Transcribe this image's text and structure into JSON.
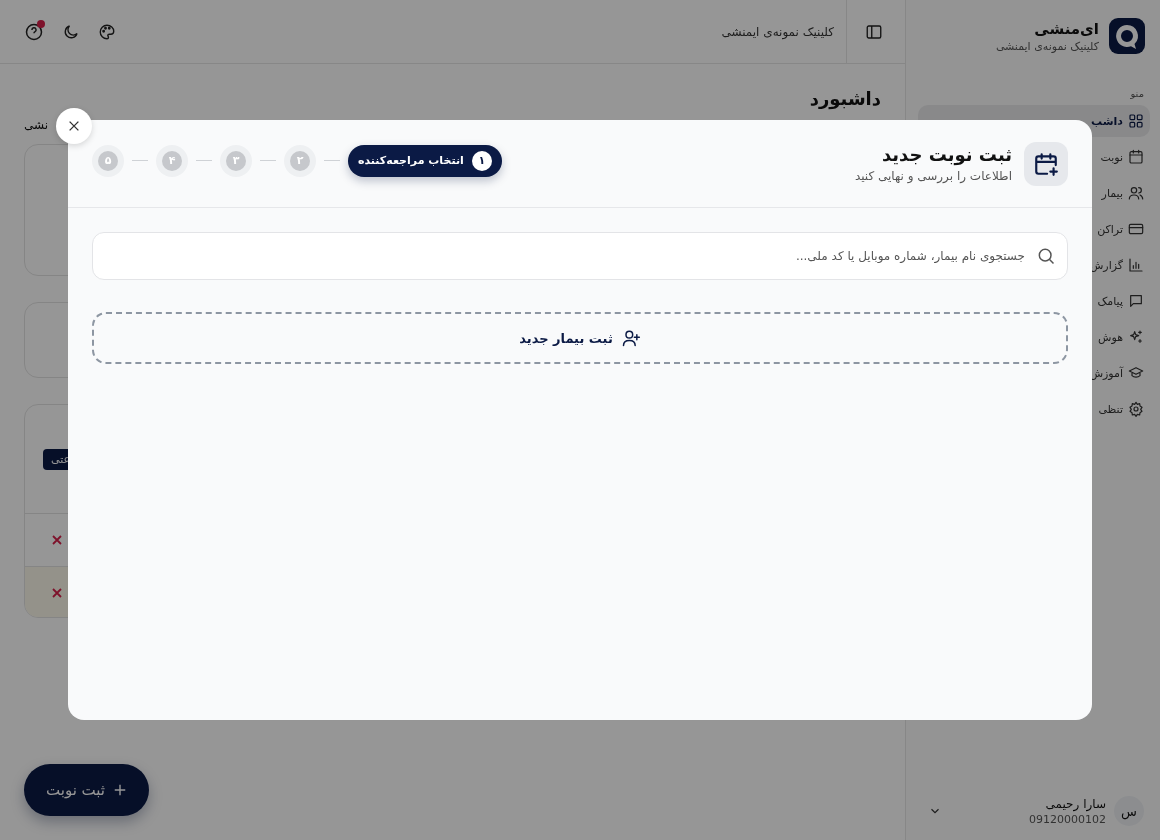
{
  "sidebar": {
    "brand": "ای‌منشی",
    "clinic": "کلینیک نمونه‌ی ایمنشی",
    "menu_label": "منو",
    "items": [
      {
        "label": "داشب",
        "selected": true
      },
      {
        "label": "نوبت",
        "selected": false
      },
      {
        "label": "بیمار",
        "selected": false
      },
      {
        "label": "تراکن",
        "selected": false
      },
      {
        "label": "گزارش",
        "selected": false
      },
      {
        "label": "پیامک",
        "selected": false
      },
      {
        "label": "هوش",
        "selected": false
      },
      {
        "label": "آموزش",
        "selected": false
      },
      {
        "label": "تنظی",
        "selected": false
      }
    ],
    "user": {
      "avatar": "س",
      "name": "سارا رحیمی",
      "phone": "09120000102"
    }
  },
  "topbar": {
    "clinic": "کلینیک نمونه‌ی ایمنشی",
    "help_notification": true
  },
  "page": {
    "title": "داشبورد",
    "fragment": "نشی",
    "badge": "عتی",
    "rows": [
      {
        "highlighted": false
      },
      {
        "highlighted": true
      }
    ]
  },
  "fab": {
    "label": "ثبت نوبت"
  },
  "modal": {
    "title": "ثبت نوبت جدید",
    "subtitle": "اطلاعات را بررسی و نهایی کنید",
    "steps": [
      {
        "number": "۱",
        "label": "انتخاب مراجعه‌کننده",
        "selected": true
      },
      {
        "number": "۲",
        "selected": false
      },
      {
        "number": "۳",
        "selected": false
      },
      {
        "number": "۴",
        "selected": false
      },
      {
        "number": "۵",
        "selected": false
      }
    ],
    "search": {
      "placeholder": "جستجوی نام بیمار، شماره موبایل یا کد ملی..."
    },
    "new_patient": "ثبت بیمار جدید"
  }
}
